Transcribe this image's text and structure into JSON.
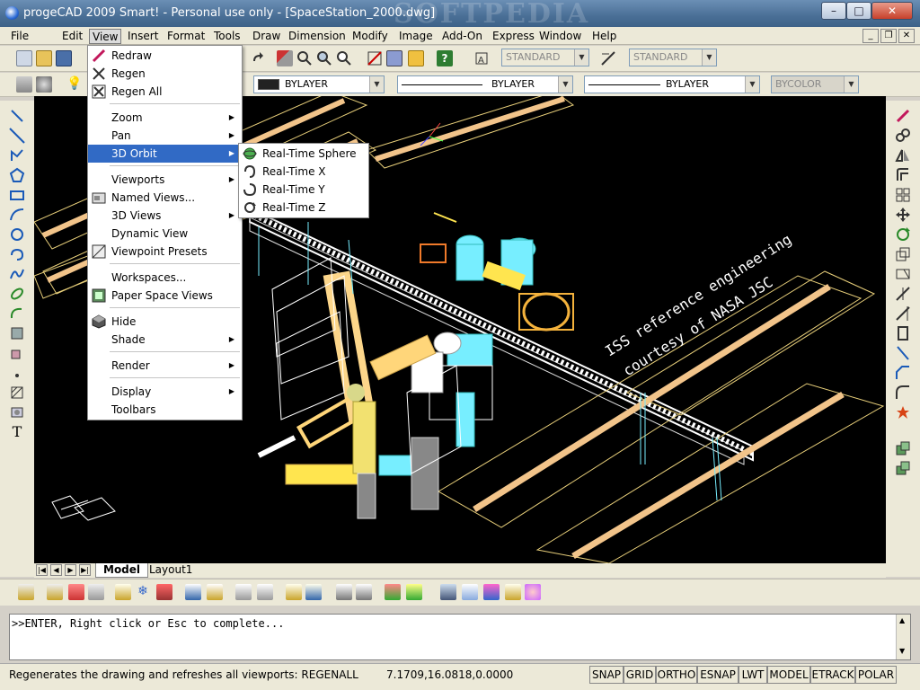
{
  "window": {
    "title": "progeCAD 2009 Smart! - Personal use only - [SpaceStation_2000.dwg]",
    "watermark": "SOFTPEDIA",
    "min": "–",
    "max": "□",
    "close": "✕"
  },
  "menubar": {
    "items": [
      "File",
      "Edit",
      "View",
      "Insert",
      "Format",
      "Tools",
      "Draw",
      "Dimension",
      "Modify",
      "Image",
      "Add-On",
      "Express",
      "Window",
      "Help"
    ],
    "active": "View",
    "mdi": {
      "min": "_",
      "restore": "❐",
      "close": "✕"
    }
  },
  "toolbar1": {
    "textstyle": "STANDARD",
    "dimstyle": "STANDARD"
  },
  "toolbar2": {
    "color": "BYLAYER",
    "linetype": "BYLAYER",
    "lineweight": "BYLAYER",
    "plotstyle": "BYCOLOR"
  },
  "view_menu": {
    "items": [
      {
        "label": "Redraw",
        "icon": "redraw-icon"
      },
      {
        "label": "Regen",
        "icon": "regen-icon"
      },
      {
        "label": "Regen All",
        "icon": "regen-all-icon"
      },
      {
        "label": "Zoom",
        "submenu": true
      },
      {
        "label": "Pan",
        "submenu": true
      },
      {
        "label": "3D Orbit",
        "submenu": true,
        "highlighted": true
      },
      {
        "label": "Viewports",
        "submenu": true
      },
      {
        "label": "Named Views...",
        "icon": "named-views-icon"
      },
      {
        "label": "3D Views",
        "submenu": true
      },
      {
        "label": "Dynamic View"
      },
      {
        "label": "Viewpoint Presets",
        "icon": "viewpoint-presets-icon"
      },
      {
        "label": "Workspaces..."
      },
      {
        "label": "Paper Space Views",
        "icon": "paper-space-icon"
      },
      {
        "label": "Hide",
        "icon": "hide-icon"
      },
      {
        "label": "Shade",
        "submenu": true
      },
      {
        "label": "Render",
        "submenu": true
      },
      {
        "label": "Display",
        "submenu": true
      },
      {
        "label": "Toolbars"
      }
    ]
  },
  "orbit_submenu": {
    "items": [
      {
        "label": "Real-Time Sphere",
        "icon": "orbit-sphere-icon"
      },
      {
        "label": "Real-Time X",
        "icon": "orbit-x-icon"
      },
      {
        "label": "Real-Time Y",
        "icon": "orbit-y-icon"
      },
      {
        "label": "Real-Time Z",
        "icon": "orbit-z-icon"
      }
    ]
  },
  "drawing": {
    "annotation_line1": "ISS reference engineering",
    "annotation_line2": "courtesy of NASA JSC"
  },
  "tabs": {
    "model": "Model",
    "layout": "Layout1"
  },
  "command_line": {
    "text": ">>ENTER, Right click or Esc to complete..."
  },
  "status": {
    "prompt": "Regenerates the drawing and refreshes all viewports:  REGENALL",
    "coords": "7.1709,16.0818,0.0000",
    "buttons": [
      "SNAP",
      "GRID",
      "ORTHO",
      "ESNAP",
      "LWT",
      "MODEL",
      "ETRACK",
      "POLAR"
    ]
  }
}
